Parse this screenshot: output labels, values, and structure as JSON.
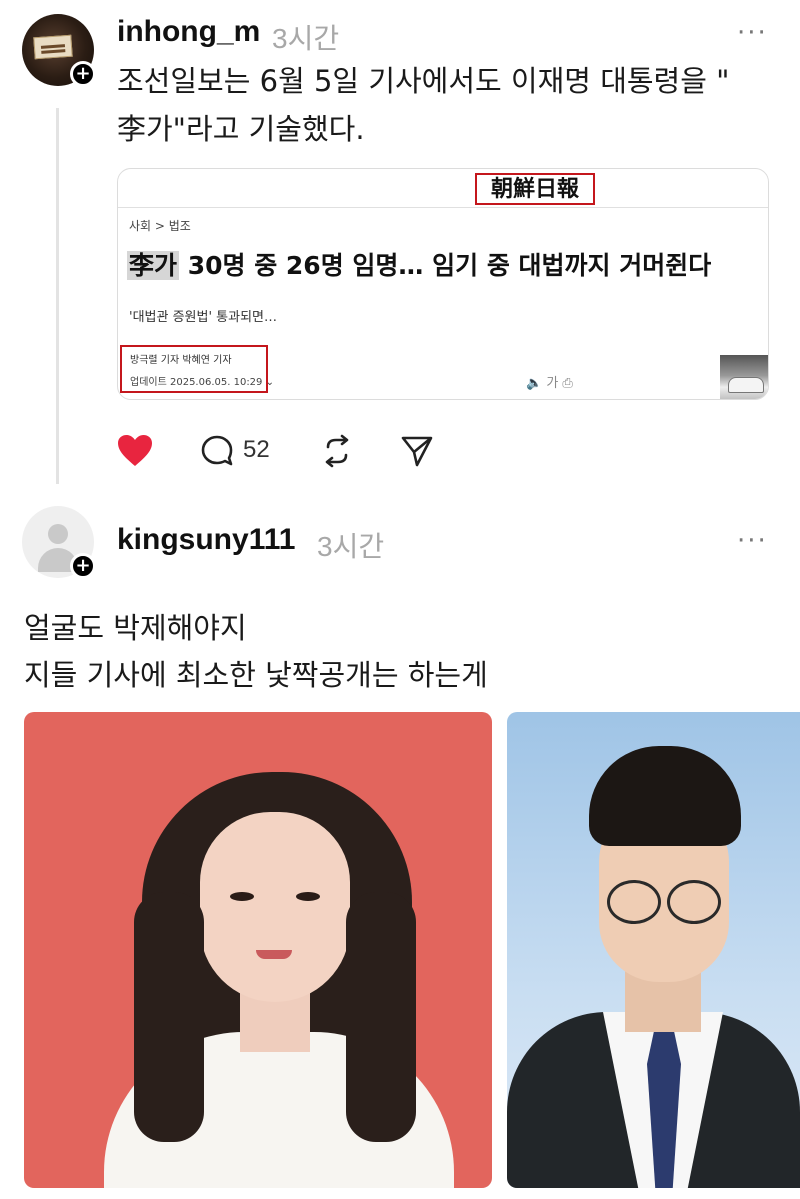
{
  "post1": {
    "username": "inhong_m",
    "time": "3시간",
    "more": "···",
    "text_line1": "조선일보는 6월 5일 기사에서도 이재명 대통령을 \"",
    "text_line2": "李가\"라고 기술했다.",
    "news": {
      "masthead": "朝鮮日報",
      "breadcrumb": "사회 > 법조",
      "headline_highlight": "李가",
      "headline_rest": " 30명 중 26명 임명… 임기 중 대법까지 거머쥔다",
      "subline": "'대법관 증원법' 통과되면…",
      "reporters": "방극렬 기자   박혜연 기자",
      "updated": "업데이트 2025.06.05. 10:29 ⌄",
      "tools": "🔈  가  ⎙"
    },
    "actions": {
      "liked": true,
      "comment_count": "52"
    }
  },
  "post2": {
    "username": "kingsuny111",
    "time": "3시간",
    "more": "···",
    "text_line1": "얼굴도 박제해야지",
    "text_line2": "지들 기사에 최소한 낯짝공개는 하는게"
  },
  "colors": {
    "like": "#e8253f",
    "highlight_box": "#c4161c",
    "muted": "#a8a8a8"
  },
  "icons": [
    "heart-icon",
    "comment-icon",
    "repost-icon",
    "share-icon",
    "more-icon",
    "follow-plus-icon"
  ]
}
